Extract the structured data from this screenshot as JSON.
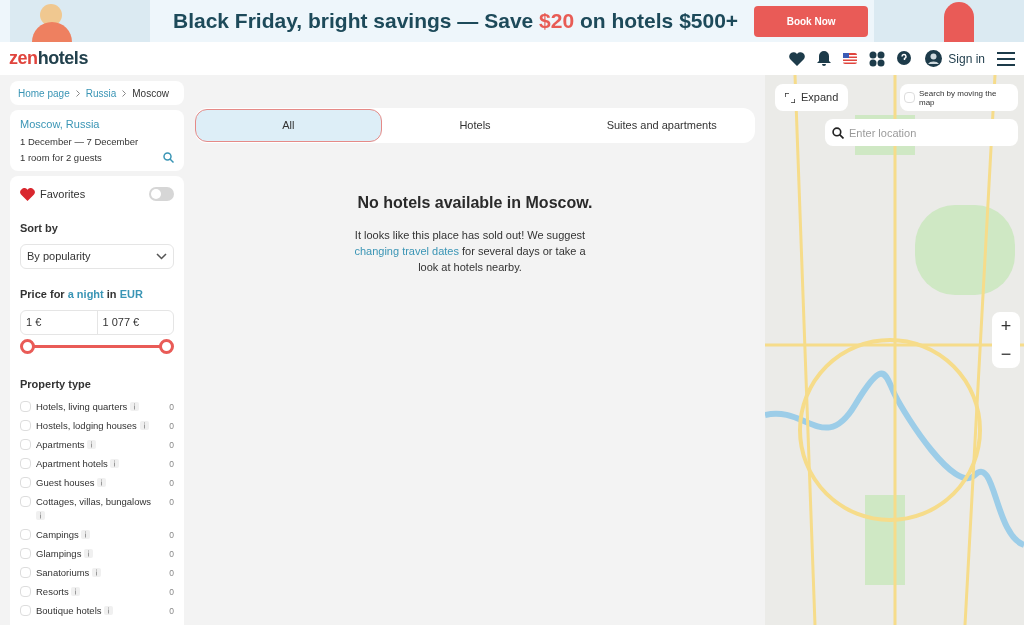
{
  "banner": {
    "headline_parts": [
      {
        "text": "Black Friday, bright savings — Save ",
        "highlight": false
      },
      {
        "text": "$20",
        "highlight": true
      },
      {
        "text": " on hotels $500+",
        "highlight": false
      }
    ],
    "button": "Book Now"
  },
  "header": {
    "logo_parts": [
      "zen",
      "hotels"
    ],
    "sign_in": "Sign in"
  },
  "breadcrumbs": [
    "Home page",
    "Russia",
    "Moscow"
  ],
  "search_summary": {
    "destination": "Moscow, Russia",
    "dates": "1 December — 7 December",
    "guests": "1 room for 2 guests"
  },
  "filters": {
    "favorites": {
      "label": "Favorites",
      "on": false
    },
    "sort": {
      "label": "Sort by",
      "value": "By popularity"
    },
    "price": {
      "label_parts": [
        {
          "text": "Price for ",
          "link": false
        },
        {
          "text": "a night",
          "link": true
        },
        {
          "text": " in ",
          "link": false
        },
        {
          "text": "EUR",
          "link": true
        }
      ],
      "min": "1 €",
      "max": "1 077 €",
      "thumbs": [
        {
          "level": 0
        },
        {
          "level": 1
        }
      ]
    },
    "property_type": {
      "label": "Property type",
      "items": [
        {
          "label": "Hotels, living quarters",
          "count": "0",
          "checked": false
        },
        {
          "label": "Hostels, lodging houses",
          "count": "0",
          "checked": false
        },
        {
          "label": "Apartments",
          "count": "0",
          "checked": false
        },
        {
          "label": "Apartment hotels",
          "count": "0",
          "checked": false
        },
        {
          "label": "Guest houses",
          "count": "0",
          "checked": false
        },
        {
          "label": "Cottages, villas, bungalows",
          "count": "0",
          "checked": false
        },
        {
          "label": "Campings",
          "count": "0",
          "checked": false
        },
        {
          "label": "Glampings",
          "count": "0",
          "checked": false
        },
        {
          "label": "Sanatoriums",
          "count": "0",
          "checked": false
        },
        {
          "label": "Resorts",
          "count": "0",
          "checked": false
        },
        {
          "label": "Boutique hotels",
          "count": "0",
          "checked": false
        }
      ]
    }
  },
  "tabs": [
    {
      "label": "All",
      "selected": true
    },
    {
      "label": "Hotels",
      "selected": false
    },
    {
      "label": "Suites and apartments",
      "selected": false
    }
  ],
  "empty_state": {
    "title": "No hotels available in Moscow.",
    "message_parts": [
      {
        "text": "It looks like this place has sold out! We suggest ",
        "link": false
      },
      {
        "text": "changing travel dates",
        "link": true
      },
      {
        "text": " for several days or take a look at hotels nearby.",
        "link": false
      }
    ]
  },
  "map": {
    "expand": "Expand",
    "move_search": {
      "label": "Search by moving the map",
      "checked": false
    },
    "location_placeholder": "Enter location",
    "zoom_in": "+",
    "zoom_out": "−"
  }
}
